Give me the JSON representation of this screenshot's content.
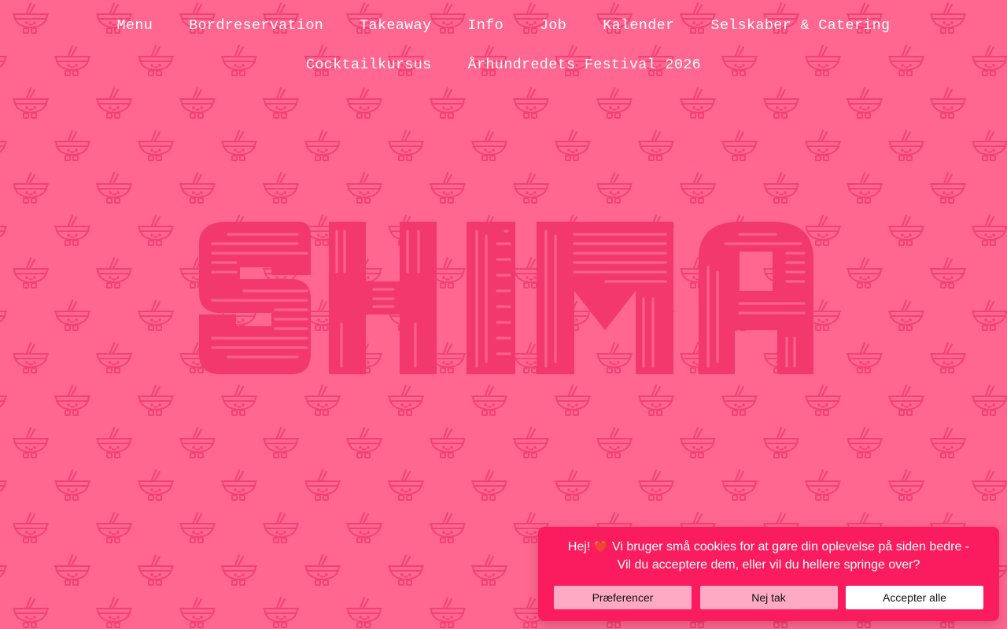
{
  "colors": {
    "background": "#ff6690",
    "pattern": "#f23a6e",
    "logo": "#f2386d",
    "cookie_banner": "#fa1c5e",
    "button_secondary": "#ffaac4",
    "button_primary": "#ffffff"
  },
  "nav": {
    "items": [
      {
        "label": "Menu"
      },
      {
        "label": "Bordreservation"
      },
      {
        "label": "Takeaway"
      },
      {
        "label": "Info"
      },
      {
        "label": "Job"
      },
      {
        "label": "Kalender"
      },
      {
        "label": "Selskaber & Catering"
      },
      {
        "label": "Cocktailkursus"
      },
      {
        "label": "Århundredets Festival 2026"
      }
    ]
  },
  "logo": {
    "text": "SHIMA"
  },
  "pattern_icon": "ramen-bowl-icon",
  "cookie": {
    "line1_prefix": "Hej!",
    "heart_icon": "heart-icon",
    "heart_glyph": "❤️",
    "line1_suffix": "Vi bruger små cookies for at gøre din oplevelse på siden bedre -",
    "line2": "Vil du acceptere dem, eller vil du hellere springe over?",
    "buttons": {
      "preferences": "Præferencer",
      "decline": "Nej tak",
      "accept": "Accepter alle"
    }
  }
}
